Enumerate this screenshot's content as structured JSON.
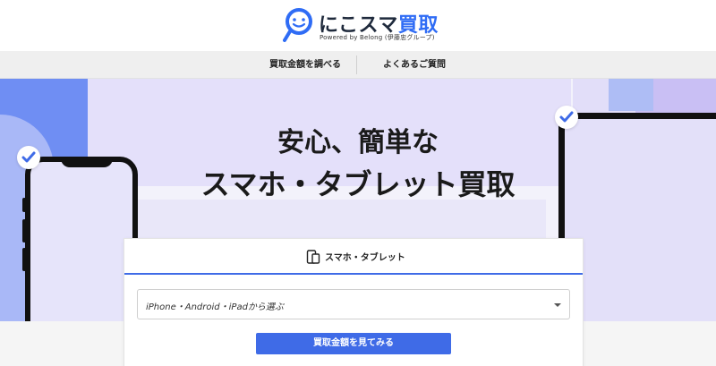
{
  "brand": {
    "name_part1": "にこスマ",
    "name_part2": "買取",
    "tagline": "Powered by Belong (伊藤忠グループ)",
    "logo_icon": "smile-magnifier-icon",
    "accent_color": "#2f6cf5"
  },
  "nav": {
    "items": [
      {
        "label": "買取金額を調べる"
      },
      {
        "label": "よくあるご質問"
      }
    ]
  },
  "hero": {
    "headline_line1": "安心、簡単な",
    "headline_line2": "スマホ・タブレット買取"
  },
  "search_card": {
    "tab_label": "スマホ・タブレット",
    "tab_icon": "devices-icon",
    "select_placeholder": "iPhone・Android・iPadから選ぶ",
    "cta_label": "買取金額を見てみる",
    "cta_color": "#3f6be7"
  }
}
